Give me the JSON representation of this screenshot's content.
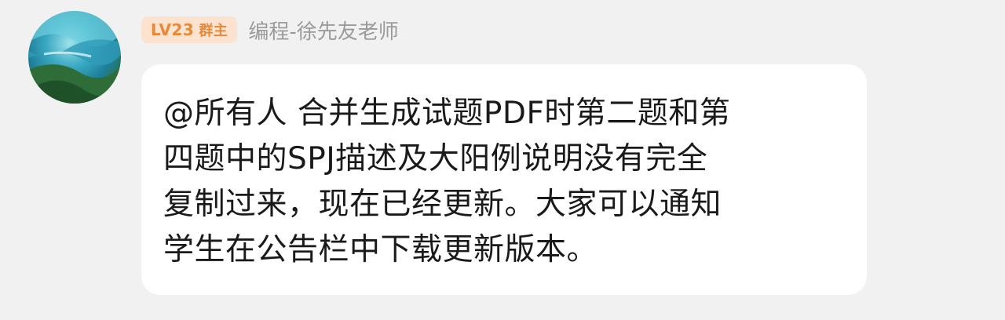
{
  "message": {
    "badge": {
      "level": "LV23",
      "role": "群主",
      "background": "#fbe3cf",
      "color": "#e8893a"
    },
    "sender_name": "编程-徐先友老师",
    "avatar_icon": "landscape-avatar",
    "text": "@所有人 合并生成试题PDF时第二题和第\n四题中的SPJ描述及大阳例说明没有完全\n复制过来，现在已经更新。大家可以通知\n学生在公告栏中下载更新版本。"
  }
}
